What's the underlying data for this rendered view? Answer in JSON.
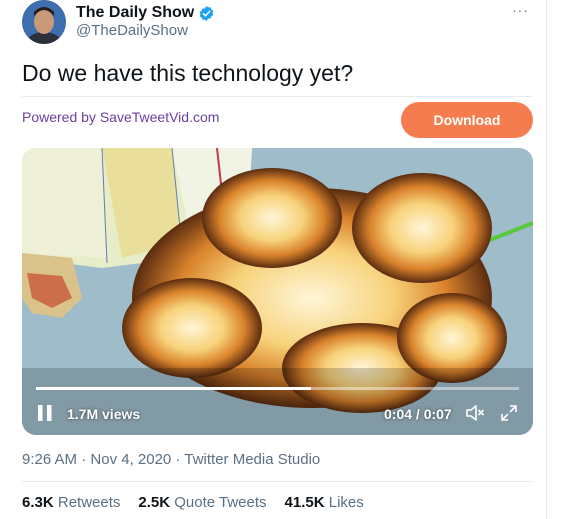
{
  "account": {
    "name": "The Daily Show",
    "handle": "@TheDailyShow",
    "verified_color": "#1da1f2"
  },
  "menu": {
    "more_label": "···"
  },
  "tweet": {
    "text": "Do we have this technology yet?"
  },
  "promo": {
    "powered_by": "Powered by SaveTweetVid.com",
    "download_label": "Download",
    "download_color": "#f47c4f"
  },
  "video": {
    "views": "1.7M views",
    "time": "0:04 / 0:07",
    "progress": 0.57
  },
  "meta": {
    "time": "9:26 AM",
    "date": "Nov 4, 2020",
    "source": "Twitter Media Studio"
  },
  "stats": {
    "retweets_count": "6.3K",
    "retweets_label": "Retweets",
    "quotes_count": "2.5K",
    "quotes_label": "Quote Tweets",
    "likes_count": "41.5K",
    "likes_label": "Likes"
  }
}
